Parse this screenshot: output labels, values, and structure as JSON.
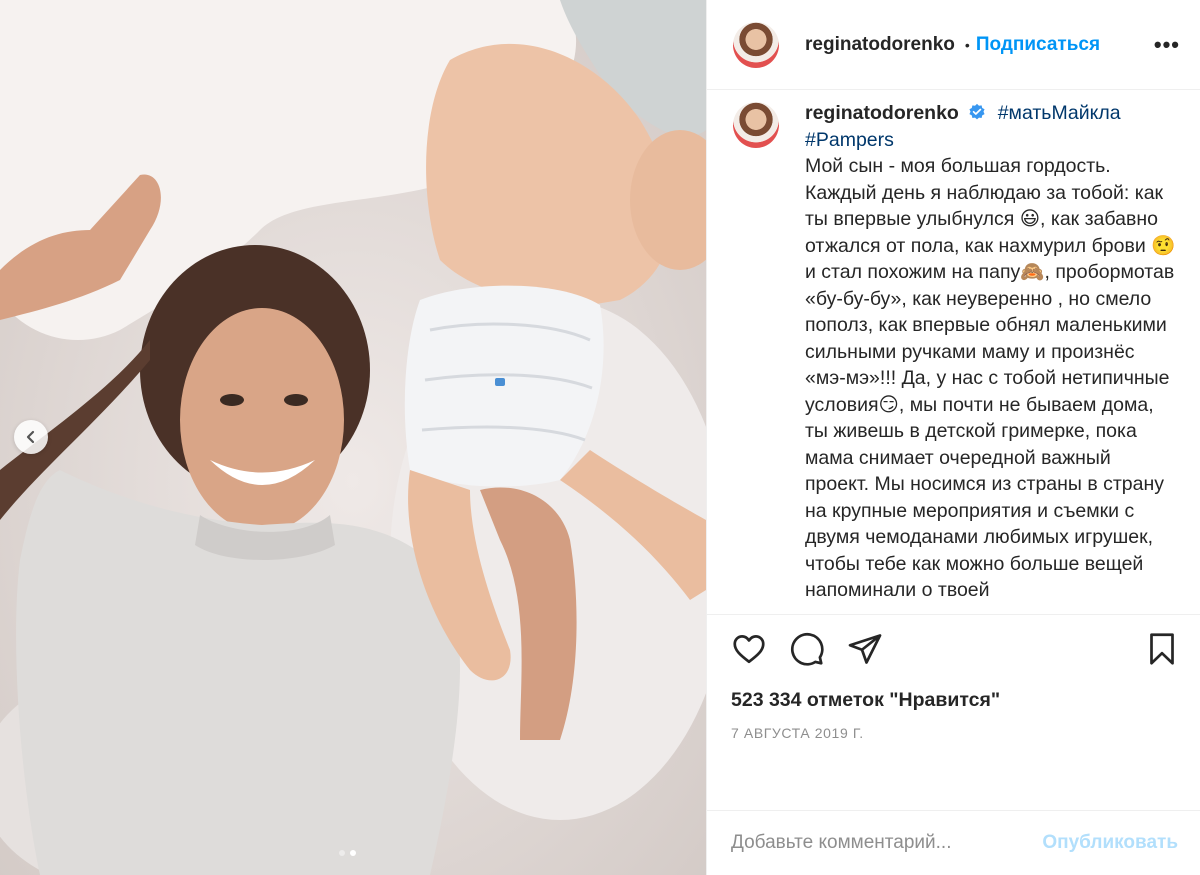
{
  "post": {
    "username": "reginatodorenko",
    "follow_label": "Подписаться",
    "dot_separator": "•",
    "more_label": "•••",
    "caption": {
      "username": "reginatodorenko",
      "tag1": "#матьМайкла",
      "tag2": "#Pampers",
      "text": "Мой сын - моя большая гордость. Каждый день я наблюдаю за тобой: как ты впервые улыбнулся 😃, как забавно отжался от пола, как нахмурил брови 🤨 и стал похожим на папу🙈, пробормотав «бу-бу-бу», как неуверенно , но смело пополз, как впервые обнял маленькими сильными ручками маму и произнёс «мэ-мэ»!!! Да, у нас с тобой нетипичные условия😏, мы почти не бываем дома, ты живешь в детской гримерке, пока мама снимает очередной важный проект. Мы носимся из страны в страну на крупные мероприятия и съемки с двумя чемоданами любимых игрушек, чтобы тебе как можно больше вещей напоминали о твоей"
    },
    "likes_text": "523 334 отметок \"Нравится\"",
    "date_text": "7 АВГУСТА 2019 Г.",
    "comment_placeholder": "Добавьте комментарий...",
    "publish_label": "Опубликовать",
    "carousel": {
      "total": 2,
      "active": 2
    }
  },
  "icons": {
    "like": "heart-icon",
    "comment": "comment-bubble-icon",
    "share": "paper-plane-icon",
    "save": "bookmark-icon",
    "verified": "verified-badge-icon",
    "prev": "chevron-left-icon"
  },
  "colors": {
    "accent": "#0095f6",
    "publish_disabled": "#b2dffc",
    "secondary_text": "#8e8e8e",
    "hashtag": "#00376b",
    "verified": "#3897f0"
  }
}
